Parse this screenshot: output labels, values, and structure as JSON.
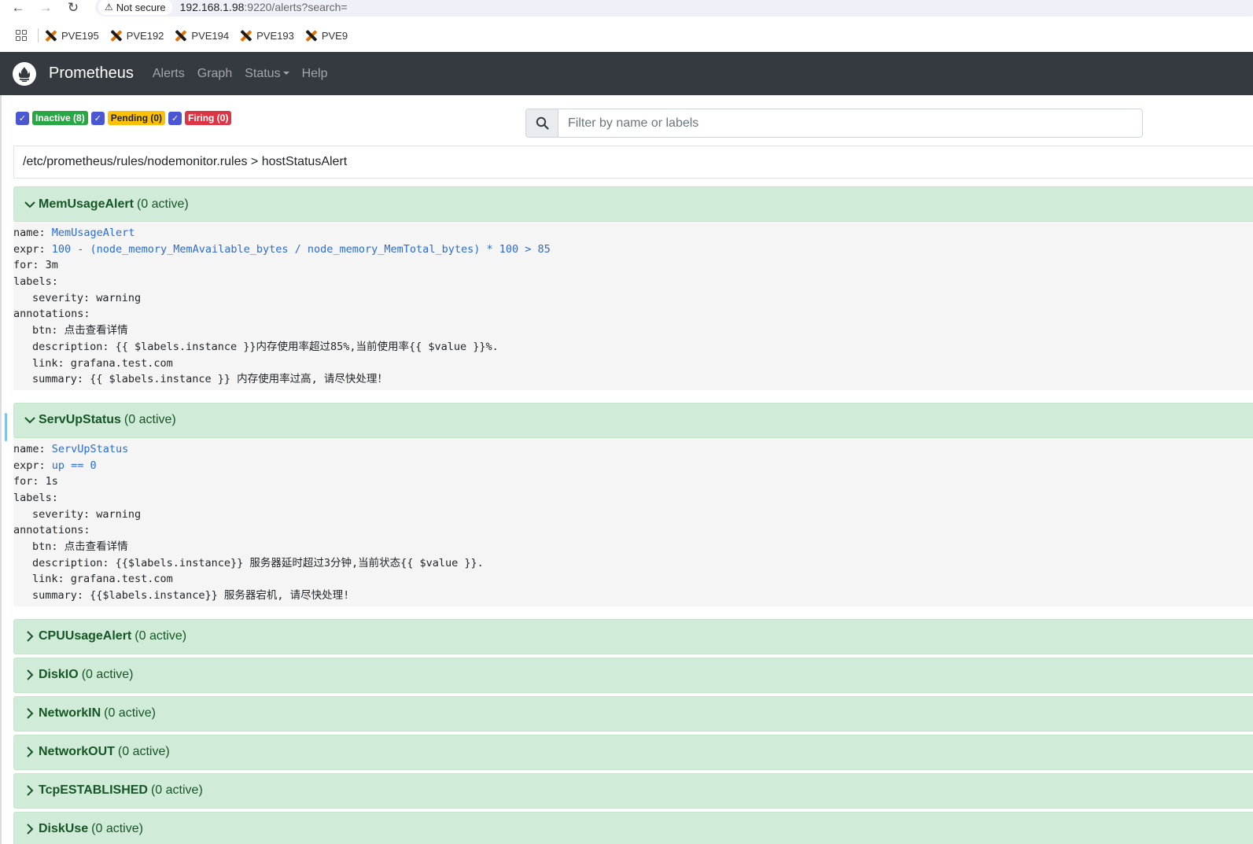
{
  "browser": {
    "security_label": "Not secure",
    "url_host": "192.168.1.98",
    "url_rest": ":9220/alerts?search=",
    "bookmarks": [
      "PVE195",
      "PVE192",
      "PVE194",
      "PVE193",
      "PVE9"
    ]
  },
  "navbar": {
    "brand": "Prometheus",
    "links": [
      "Alerts",
      "Graph",
      "Status",
      "Help"
    ]
  },
  "filters": {
    "inactive": "Inactive (8)",
    "pending": "Pending (0)",
    "firing": "Firing (0)"
  },
  "search": {
    "placeholder": "Filter by name or labels"
  },
  "group": {
    "path": "/etc/prometheus/rules/nodemonitor.rules > hostStatusAlert"
  },
  "rules": [
    {
      "name": "MemUsageAlert",
      "active": "(0 active)",
      "expanded": true,
      "lines": {
        "name_key": "name: ",
        "name_val": "MemUsageAlert",
        "expr_key": "expr: ",
        "expr_val": "100 - (node_memory_MemAvailable_bytes / node_memory_MemTotal_bytes) * 100 > 85",
        "for": "for: 3m",
        "labels": "labels:",
        "severity": "severity: warning",
        "annotations": "annotations:",
        "btn": "btn: 点击查看详情",
        "description": "description: {{ $labels.instance }}内存使用率超过85%,当前使用率{{ $value }}%.",
        "link": "link: grafana.test.com",
        "summary": "summary: {{ $labels.instance }} 内存使用率过高, 请尽快处理！"
      }
    },
    {
      "name": "ServUpStatus",
      "active": "(0 active)",
      "expanded": true,
      "lines": {
        "name_key": "name: ",
        "name_val": "ServUpStatus",
        "expr_key": "expr: ",
        "expr_val": "up == 0",
        "for": "for: 1s",
        "labels": "labels:",
        "severity": "severity: warning",
        "annotations": "annotations:",
        "btn": "btn: 点击查看详情",
        "description": "description: {{$labels.instance}} 服务器延时超过3分钟,当前状态{{ $value }}.",
        "link": "link: grafana.test.com",
        "summary": "summary: {{$labels.instance}} 服务器宕机, 请尽快处理!"
      }
    },
    {
      "name": "CPUUsageAlert",
      "active": "(0 active)",
      "expanded": false
    },
    {
      "name": "DiskIO",
      "active": "(0 active)",
      "expanded": false
    },
    {
      "name": "NetworkIN",
      "active": "(0 active)",
      "expanded": false
    },
    {
      "name": "NetworkOUT",
      "active": "(0 active)",
      "expanded": false
    },
    {
      "name": "TcpESTABLISHED",
      "active": "(0 active)",
      "expanded": false
    },
    {
      "name": "DiskUse",
      "active": "(0 active)",
      "expanded": false
    }
  ],
  "colors": {
    "navbar": "#343a40",
    "rule_header_bg": "#d1ebd9",
    "rule_header_text": "#155724",
    "checkbox": "#4b56d2",
    "inactive": "#28a745",
    "pending": "#ffc107",
    "firing": "#dc3545"
  }
}
